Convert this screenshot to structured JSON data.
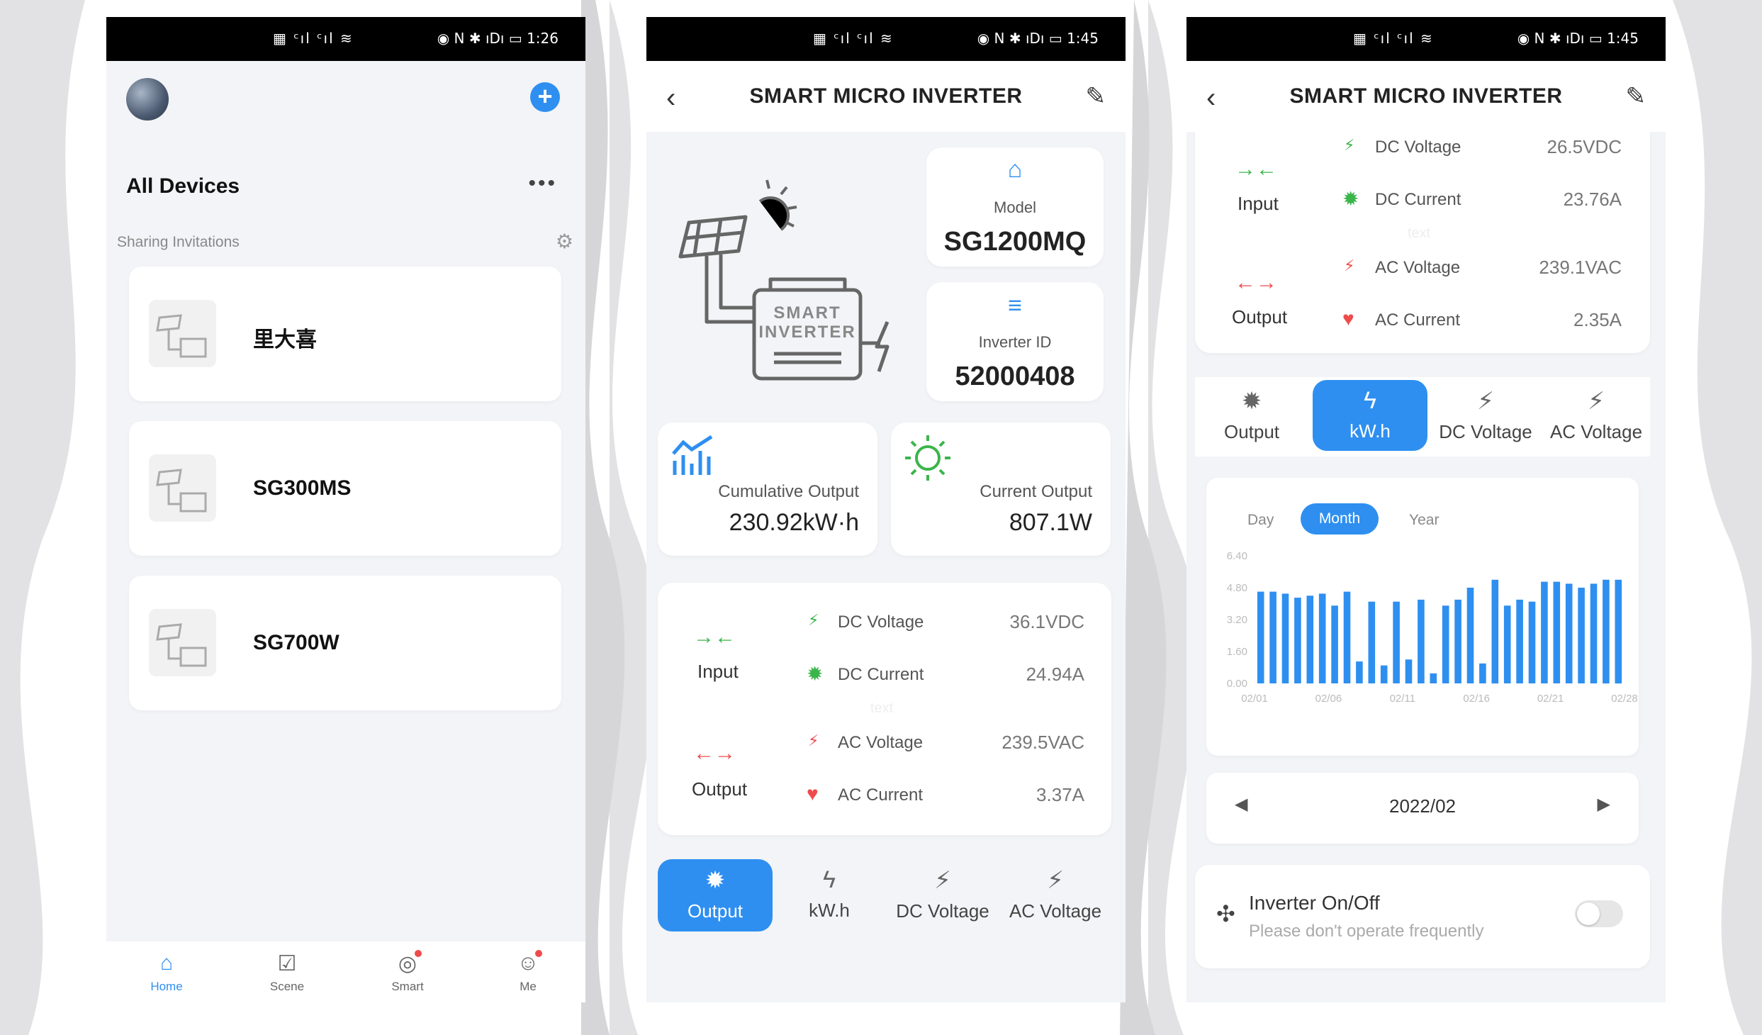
{
  "status": {
    "left_icons": "▦ ᶜıl ᶜıl ≋",
    "screen1_right": "◉ N ✱ ıDı ▭ 1:26",
    "screen2_right": "◉ N ✱ ıDı ▭ 1:45",
    "screen3_right": "◉ N ✱ ıDı ▭ 1:45"
  },
  "colors": {
    "accent": "#2e8ff0",
    "green": "#3bb54a",
    "red": "#ee4c4c",
    "card": "#ffffff",
    "bg": "#f3f4f7"
  },
  "home": {
    "title": "All Devices",
    "more_icon": "more-icon",
    "sharing": "Sharing Invitations",
    "devices": [
      {
        "name": "里大喜"
      },
      {
        "name": "SG300MS"
      },
      {
        "name": "SG700W"
      }
    ],
    "nav": [
      {
        "label": "Home",
        "icon": "home-icon"
      },
      {
        "label": "Scene",
        "icon": "check-square-icon"
      },
      {
        "label": "Smart",
        "icon": "smart-icon"
      },
      {
        "label": "Me",
        "icon": "user-icon"
      }
    ]
  },
  "inverter": {
    "title": "SMART MICRO INVERTER",
    "illustration_text": [
      "SMART",
      "INVERTER"
    ],
    "model_label": "Model",
    "model_value": "SG1200MQ",
    "id_label": "Inverter ID",
    "id_value": "52000408",
    "cumulative_label": "Cumulative Output",
    "cumulative_value": "230.92kW·h",
    "current_label": "Current Output",
    "current_value": "807.1W",
    "input_label": "Input",
    "output_label": "Output",
    "watermark": "text",
    "rows": [
      {
        "label": "DC Voltage",
        "value": "36.1VDC"
      },
      {
        "label": "DC Current",
        "value": "24.94A"
      },
      {
        "label": "AC Voltage",
        "value": "239.5VAC"
      },
      {
        "label": "AC Current",
        "value": "3.37A"
      }
    ],
    "tabs": [
      {
        "label": "Output",
        "icon": "gear-icon"
      },
      {
        "label": "kW.h",
        "icon": "lightning-icon"
      },
      {
        "label": "DC Voltage",
        "icon": "dc-voltage-icon"
      },
      {
        "label": "AC Voltage",
        "icon": "ac-voltage-icon"
      }
    ]
  },
  "detail": {
    "title": "SMART MICRO INVERTER",
    "input_label": "Input",
    "output_label": "Output",
    "watermark": "text",
    "rows": [
      {
        "label": "DC Voltage",
        "value": "26.5VDC"
      },
      {
        "label": "DC Current",
        "value": "23.76A"
      },
      {
        "label": "AC Voltage",
        "value": "239.1VAC"
      },
      {
        "label": "AC Current",
        "value": "2.35A"
      }
    ],
    "tabs": [
      {
        "label": "Output"
      },
      {
        "label": "kW.h"
      },
      {
        "label": "DC Voltage"
      },
      {
        "label": "AC Voltage"
      }
    ],
    "periods": [
      "Day",
      "Month",
      "Year"
    ],
    "selected_period": "Month",
    "date_nav": "2022/02",
    "toggle_title": "Inverter On/Off",
    "toggle_sub": "Please don't operate frequently",
    "toggle_on": false
  },
  "chart_data": {
    "type": "bar",
    "ylim": [
      0,
      6.4
    ],
    "y_ticks": [
      "0.00",
      "1.60",
      "3.20",
      "4.80",
      "6.40"
    ],
    "x_ticks": [
      "02/01",
      "02/06",
      "02/11",
      "02/16",
      "02/21",
      "02/28"
    ],
    "values": [
      4.6,
      4.6,
      4.5,
      4.3,
      4.4,
      4.5,
      3.9,
      4.6,
      1.1,
      4.1,
      0.9,
      4.1,
      1.2,
      4.2,
      0.5,
      3.9,
      4.2,
      4.8,
      1.0,
      5.2,
      3.9,
      4.2,
      4.1,
      5.1,
      5.1,
      5.0,
      4.8,
      5.0,
      5.2,
      5.2
    ]
  }
}
